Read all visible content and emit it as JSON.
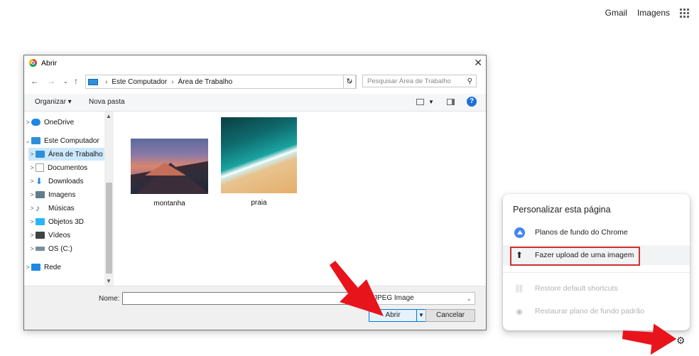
{
  "top_links": {
    "gmail": "Gmail",
    "images": "Imagens"
  },
  "dialog": {
    "title": "Abrir",
    "breadcrumb": [
      "Este Computador",
      "Área de Trabalho"
    ],
    "search_placeholder": "Pesquisar Área de Trabalho",
    "toolbar": {
      "organize": "Organizar ▾",
      "new_folder": "Nova pasta"
    },
    "tree": [
      {
        "label": "OneDrive",
        "expander": ">",
        "color": "#1e88e5"
      },
      {
        "label": "Este Computador",
        "expander": "⌄",
        "color": "#2d8fdb"
      },
      {
        "label": "Área de Trabalho",
        "expander": ">",
        "color": "#2d8fdb"
      },
      {
        "label": "Documentos",
        "expander": ">",
        "color": "#9e9e9e"
      },
      {
        "label": "Downloads",
        "expander": ">",
        "color": "#1e88e5"
      },
      {
        "label": "Imagens",
        "expander": ">",
        "color": "#607d8b"
      },
      {
        "label": "Músicas",
        "expander": ">",
        "color": "#1565c0"
      },
      {
        "label": "Objetos 3D",
        "expander": ">",
        "color": "#29b6f6"
      },
      {
        "label": "Vídeos",
        "expander": ">",
        "color": "#424242"
      },
      {
        "label": "OS (C:)",
        "expander": ">",
        "color": "#78909c"
      },
      {
        "label": "Rede",
        "expander": ">",
        "color": "#1e88e5"
      }
    ],
    "files": [
      {
        "name": "montanha"
      },
      {
        "name": "praia"
      }
    ],
    "name_label": "Nome:",
    "name_value": "",
    "file_type": "JPEG Image",
    "open_button": "Abrir",
    "cancel_button": "Cancelar"
  },
  "panel": {
    "title": "Personalizar esta página",
    "items": [
      {
        "label": "Planos de fundo do Chrome"
      },
      {
        "label": "Fazer upload de uma imagem"
      },
      {
        "label": "Restore default shortcuts"
      },
      {
        "label": "Restaurar plano de fundo padrão"
      }
    ]
  },
  "colors": {
    "highlight_red": "#d32f2f",
    "arrow_red": "#e8141c",
    "win_blue": "#0078d7"
  }
}
